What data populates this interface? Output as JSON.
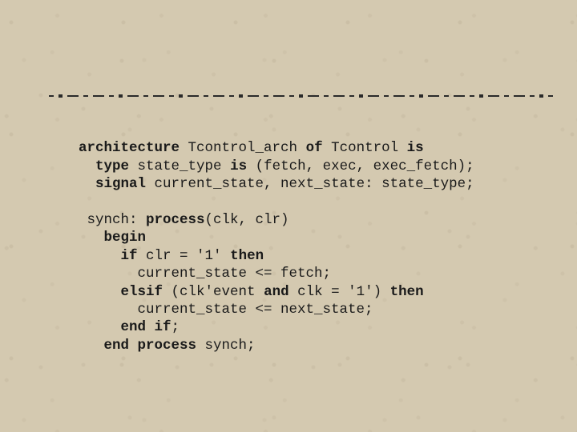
{
  "code": {
    "l1": {
      "kw1": "architecture",
      "t1": " Tcontrol_arch ",
      "kw2": "of",
      "t2": " Tcontrol ",
      "kw3": "is"
    },
    "l2": {
      "pad": "  ",
      "kw1": "type",
      "t1": " state_type ",
      "kw2": "is",
      "t2": " (fetch, exec, exec_fetch);"
    },
    "l3": {
      "pad": "  ",
      "kw1": "signal",
      "t1": " current_state, next_state: state_type;"
    },
    "blank1": "",
    "l4": {
      "pad": " ",
      "t1": "synch: ",
      "kw1": "process",
      "t2": "(clk, clr)"
    },
    "l5": {
      "pad": "   ",
      "kw1": "begin"
    },
    "l6": {
      "pad": "     ",
      "kw1": "if",
      "t1": " clr = '1' ",
      "kw2": "then"
    },
    "l7": {
      "pad": "       ",
      "t1": "current_state <= fetch;"
    },
    "l8": {
      "pad": "     ",
      "kw1": "elsif",
      "t1": " (clk'event ",
      "kw2": "and",
      "t2": " clk = '1') ",
      "kw3": "then"
    },
    "l9": {
      "pad": "       ",
      "t1": "current_state <= next_state;"
    },
    "l10": {
      "pad": "     ",
      "kw1": "end if",
      "t1": ";"
    },
    "l11": {
      "pad": "   ",
      "kw1": "end process",
      "t1": " synch;"
    }
  }
}
